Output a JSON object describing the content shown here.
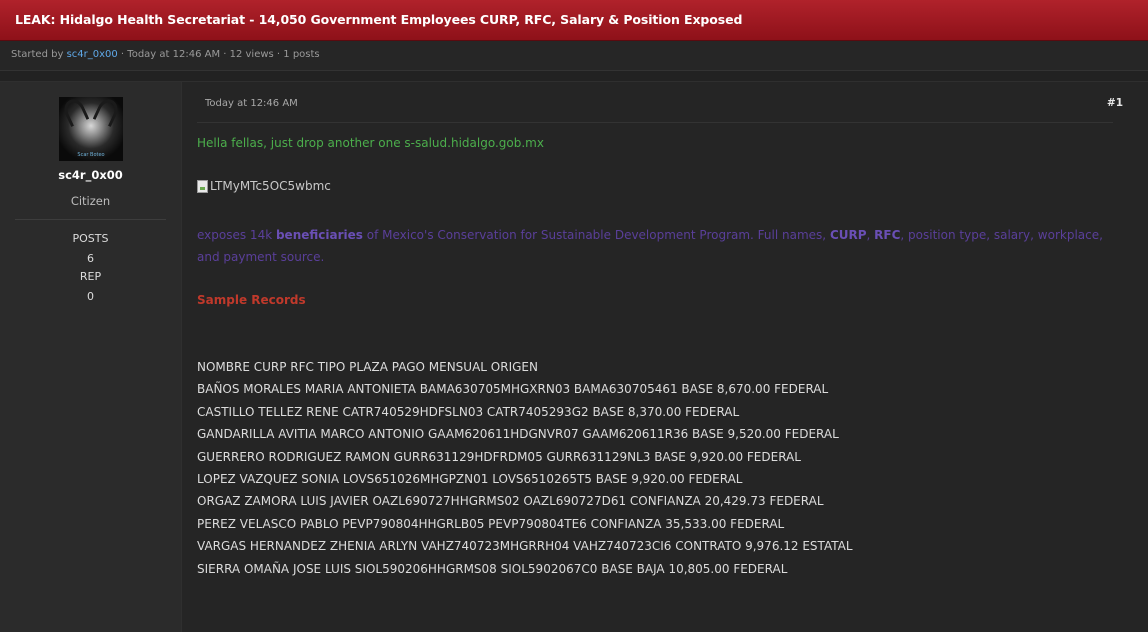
{
  "thread": {
    "title": "LEAK: Hidalgo Health Secretariat - 14,050 Government Employees CURP, RFC, Salary & Position Exposed",
    "meta_prefix": "Started by ",
    "author": "sc4r_0x00",
    "meta_suffix": " · Today at 12:46 AM · 12 views · 1 posts"
  },
  "user": {
    "avatar_caption": "Scar Boteo",
    "name": "sc4r_0x00",
    "title": "Citizen",
    "posts_label": "POSTS",
    "posts_value": "6",
    "rep_label": "REP",
    "rep_value": "0"
  },
  "post": {
    "time": "Today at 12:46 AM",
    "number": "#1",
    "intro": "Hella fellas, just drop another one s-salud.hidalgo.gob.mx",
    "image_alt": "LTMyMTc5OC5wbmc",
    "desc_1": "exposes 14k ",
    "desc_b1": "beneficiaries",
    "desc_2": " of Mexico's Conservation for Sustainable Development Program. Full names, ",
    "desc_b2": "CURP",
    "desc_3": ", ",
    "desc_b3": "RFC",
    "desc_4": ", position type, salary, workplace, and payment source.",
    "sample_heading": "Sample Records",
    "records": [
      "NOMBRE CURP RFC TIPO PLAZA PAGO MENSUAL ORIGEN",
      "BAÑOS MORALES MARIA ANTONIETA BAMA630705MHGXRN03 BAMA630705461 BASE 8,670.00 FEDERAL",
      "CASTILLO TELLEZ RENE CATR740529HDFSLN03 CATR7405293G2 BASE 8,370.00 FEDERAL",
      "GANDARILLA AVITIA MARCO ANTONIO GAAM620611HDGNVR07 GAAM620611R36 BASE 9,520.00 FEDERAL",
      "GUERRERO RODRIGUEZ RAMON GURR631129HDFRDM05 GURR631129NL3 BASE 9,920.00 FEDERAL",
      "LOPEZ VAZQUEZ SONIA LOVS651026MHGPZN01 LOVS6510265T5 BASE 9,920.00 FEDERAL",
      "ORGAZ ZAMORA LUIS JAVIER OAZL690727HHGRMS02 OAZL690727D61 CONFIANZA 20,429.73 FEDERAL",
      "PEREZ VELASCO PABLO PEVP790804HHGRLB05 PEVP790804TE6 CONFIANZA 35,533.00 FEDERAL",
      "VARGAS HERNANDEZ ZHENIA ARLYN VAHZ740723MHGRRH04 VAHZ740723CI6 CONTRATO 9,976.12 ESTATAL",
      "SIERRA OMAÑA JOSE LUIS SIOL590206HHGRMS08 SIOL5902067C0 BASE BAJA 10,805.00 FEDERAL"
    ]
  }
}
